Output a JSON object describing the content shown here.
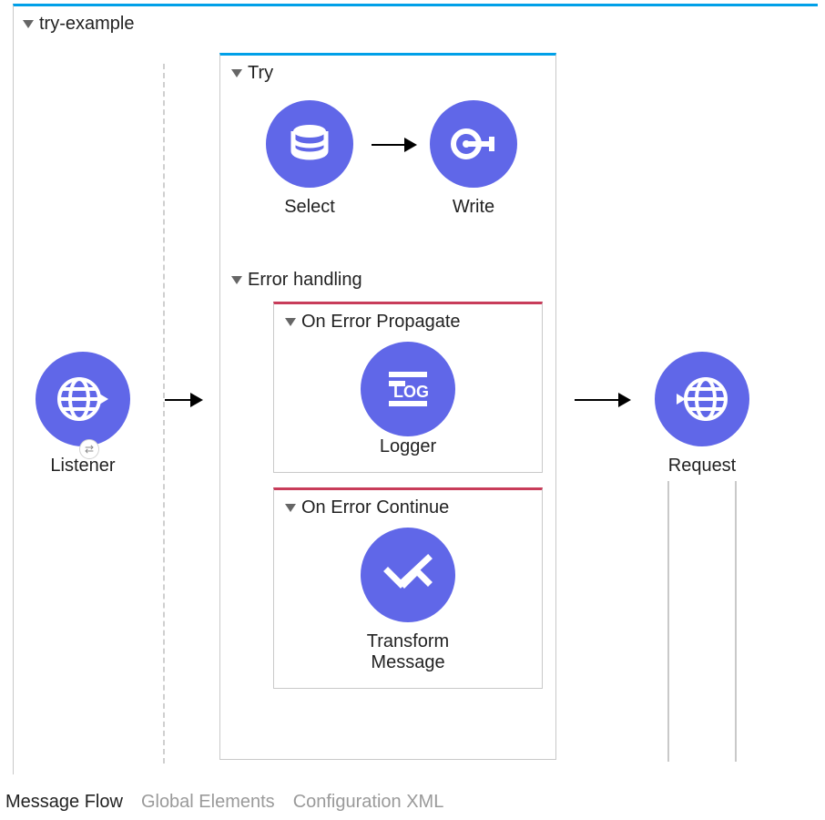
{
  "flow": {
    "title": "try-example"
  },
  "nodes": {
    "listener": "Listener",
    "select": "Select",
    "write": "Write",
    "logger": "Logger",
    "transform": "Transform Message",
    "request": "Request"
  },
  "scopes": {
    "try": "Try",
    "errorHandling": "Error handling",
    "onErrorPropagate": "On Error Propagate",
    "onErrorContinue": "On Error Continue"
  },
  "tabs": {
    "messageFlow": "Message Flow",
    "globalElements": "Global Elements",
    "configXml": "Configuration XML"
  }
}
